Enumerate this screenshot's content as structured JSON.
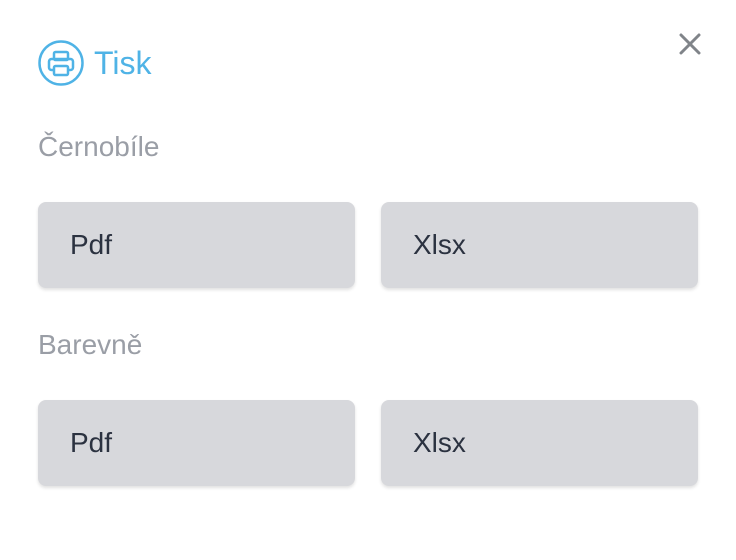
{
  "dialog": {
    "title": "Tisk",
    "icon": "printer-icon",
    "close_icon": "close-icon",
    "accent_color": "#4fb3e6"
  },
  "sections": [
    {
      "label": "Černobíle",
      "buttons": [
        {
          "label": "Pdf"
        },
        {
          "label": "Xlsx"
        }
      ]
    },
    {
      "label": "Barevně",
      "buttons": [
        {
          "label": "Pdf"
        },
        {
          "label": "Xlsx"
        }
      ]
    }
  ]
}
